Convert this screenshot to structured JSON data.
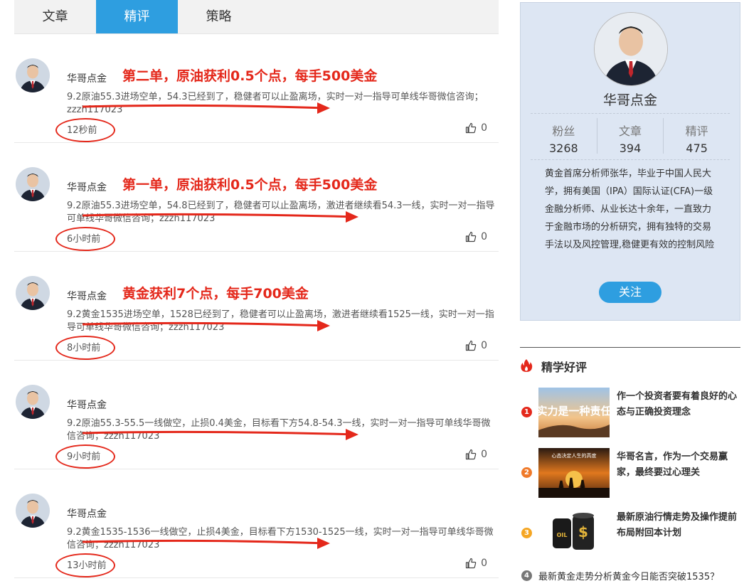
{
  "tabs": [
    {
      "label": "文章"
    },
    {
      "label": "精评"
    },
    {
      "label": "策略"
    }
  ],
  "feed": [
    {
      "author": "华哥点金",
      "headline": "第二单，原油获利0.5个点，每手500美金",
      "text": "9.2原油55.3进场空单，54.3已经到了，稳健者可以止盈离场，实时一对一指导可单线华哥微信咨询；zzzh117023",
      "time": "12秒前",
      "likes": "0"
    },
    {
      "author": "华哥点金",
      "headline": "第一单，原油获利0.5个点，每手500美金",
      "text": "9.2原油55.3进场空单，54.8已经到了，稳健者可以止盈离场，激进者继续看54.3一线，实时一对一指导可单线华哥微信咨询；zzzh117023",
      "time": "6小时前",
      "likes": "0"
    },
    {
      "author": "华哥点金",
      "headline": "黄金获利7个点，每手700美金",
      "text": "9.2黄金1535进场空单，1528已经到了，稳健者可以止盈离场，激进者继续看1525一线，实时一对一指导可单线华哥微信咨询；zzzh117023",
      "time": "8小时前",
      "likes": "0"
    },
    {
      "author": "华哥点金",
      "headline": "",
      "text": "9.2原油55.3-55.5一线做空，止损0.4美金，目标看下方54.8-54.3一线，实时一对一指导可单线华哥微信咨询；zzzh117023",
      "time": "9小时前",
      "likes": "0"
    },
    {
      "author": "华哥点金",
      "headline": "",
      "text": "9.2黄金1535-1536一线做空，止损4美金，目标看下方1530-1525一线，实时一对一指导可单线华哥微信咨询；zzzh117023",
      "time": "13小时前",
      "likes": "0"
    }
  ],
  "profile": {
    "name": "华哥点金",
    "stats": [
      {
        "label": "粉丝",
        "value": "3268"
      },
      {
        "label": "文章",
        "value": "394"
      },
      {
        "label": "精评",
        "value": "475"
      }
    ],
    "bio": "黄金首席分析师张华，毕业于中国人民大学，拥有美国（IPA）国际认证(CFA)一级金融分析师、从业长达十余年，一直致力于金融市场的分析研究，拥有独特的交易手法以及风控管理,稳健更有效的控制风险",
    "follow_label": "关注"
  },
  "recommend": {
    "title": "精学好评",
    "items": [
      {
        "num": "1",
        "title": "作一个投资者要有着良好的心态与正确投资理念",
        "thumb_caption": "实力是一种责任",
        "color": "#e4281b"
      },
      {
        "num": "2",
        "title": "华哥名言，作为一个交易赢家，最终要过心理关",
        "thumb_caption": "心态决定人生的高度",
        "color": "#f07a2a"
      },
      {
        "num": "3",
        "title": "最新原油行情走势及操作提前布局附回本计划",
        "thumb_caption": "OIL",
        "color": "#f5a623"
      }
    ],
    "last": {
      "num": "4",
      "title": "最新黄金走势分析黄金今日能否突破1535？",
      "color": "#777777"
    }
  }
}
